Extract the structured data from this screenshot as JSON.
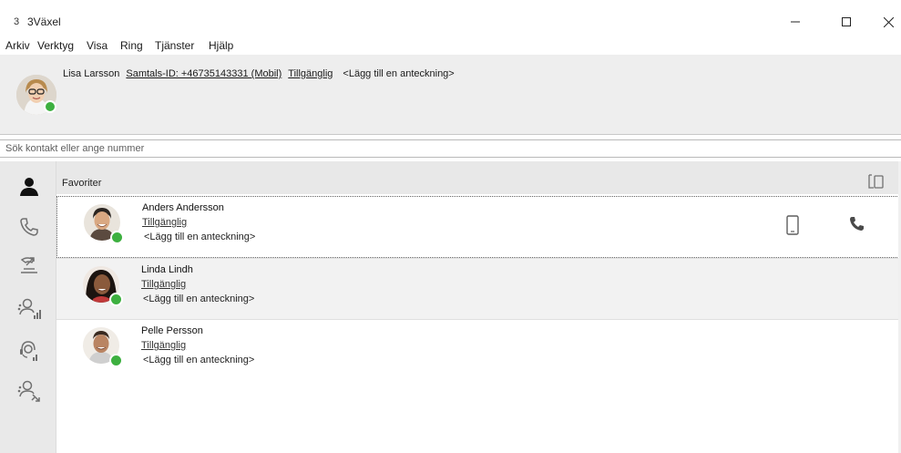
{
  "window": {
    "title": "3Växel",
    "logo_glyph": "3",
    "minimize_icon": "minimize-icon",
    "maximize_icon": "maximize-icon",
    "close_icon": "close-icon"
  },
  "menu": {
    "items": [
      "Arkiv",
      "Verktyg",
      "Visa",
      "Ring",
      "Tjänster",
      "Hjälp"
    ]
  },
  "me": {
    "name": "Lisa Larsson",
    "call_id": "Samtals-ID: +46735143331 (Mobil)",
    "status": "Tillgänglig",
    "note": "<Lägg till en anteckning>",
    "status_color": "#3db040"
  },
  "search": {
    "placeholder": "Sök kontakt eller ange nummer",
    "value": ""
  },
  "sidebar": {
    "items": [
      {
        "icon": "contacts-icon"
      },
      {
        "icon": "phone-icon"
      },
      {
        "icon": "call-log-icon"
      },
      {
        "icon": "group-status-icon"
      },
      {
        "icon": "queue-icon"
      },
      {
        "icon": "group-transfer-icon"
      }
    ]
  },
  "favorites": {
    "title": "Favoriter",
    "header_icon": "devices-icon",
    "contacts": [
      {
        "name": "Anders Andersson",
        "status": "Tillgänglig",
        "note": "<Lägg till en anteckning>"
      },
      {
        "name": "Linda Lindh",
        "status": "Tillgänglig",
        "note": "<Lägg till en anteckning>"
      },
      {
        "name": "Pelle Persson",
        "status": "Tillgänglig",
        "note": "<Lägg till en anteckning>"
      }
    ]
  },
  "colors": {
    "available": "#3db040",
    "panel": "#eeeeee",
    "sidebar": "#e9e9e9"
  }
}
